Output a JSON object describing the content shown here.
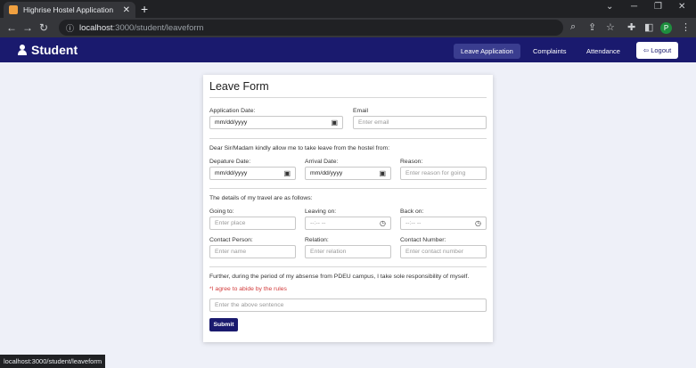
{
  "browser": {
    "tab_title": "Highrise Hostel Application",
    "tab_close": "✕",
    "new_tab": "+",
    "url_host": "localhost",
    "url_path": ":3000/student/leaveform",
    "status_url": "localhost:3000/student/leaveform",
    "profile_initial": "P"
  },
  "navbar": {
    "brand": "Student",
    "links": [
      "Leave Application",
      "Complaints",
      "Attendance"
    ],
    "active": "Leave Application",
    "logout": "Logout"
  },
  "form": {
    "title": "Leave Form",
    "application_date": {
      "label": "Application Date:",
      "value": "mm/dd/yyyy"
    },
    "email": {
      "label": "Email",
      "placeholder": "Enter email"
    },
    "intro_sentence": "Dear Sir/Madam kindly allow me to take leave from the hostel from:",
    "departure_date": {
      "label": "Depature Date:",
      "value": "mm/dd/yyyy"
    },
    "arrival_date": {
      "label": "Arrival Date:",
      "value": "mm/dd/yyyy"
    },
    "reason": {
      "label": "Reason:",
      "placeholder": "Enter reason for going"
    },
    "travel_sentence": "The details of my travel are as follows:",
    "going_to": {
      "label": "Going to:",
      "placeholder": "Enter place"
    },
    "leaving_on": {
      "label": "Leaving on:",
      "value": "--:-- --"
    },
    "back_on": {
      "label": "Back on:",
      "value": "--:-- --"
    },
    "contact_person": {
      "label": "Contact Person:",
      "placeholder": "Enter name"
    },
    "relation": {
      "label": "Relation:",
      "placeholder": "Enter relation"
    },
    "contact_number": {
      "label": "Contact Number:",
      "placeholder": "Enter contact number"
    },
    "responsibility_sentence": "Further, during the period of my absense from PDEU campus, I take sole responsibility of myself.",
    "agree_text": "*I agree to abide by the rules",
    "confirm_placeholder": "Enter the above sentence",
    "submit": "Submit"
  }
}
